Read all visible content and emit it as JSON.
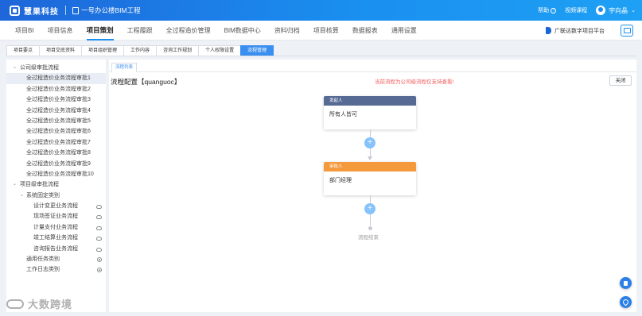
{
  "app": {
    "logo_text": "慧果科技",
    "project_name": "一号办公楼BIM工程"
  },
  "topbar": {
    "help_label": "帮助",
    "course_label": "视频课程",
    "user_name": "宇向晶"
  },
  "mainnav": {
    "items": [
      {
        "label": "项目BI"
      },
      {
        "label": "项目信息"
      },
      {
        "label": "项目策划"
      },
      {
        "label": "工程履跟"
      },
      {
        "label": "全过程造价管理"
      },
      {
        "label": "BIM数据中心"
      },
      {
        "label": "资料归档"
      },
      {
        "label": "项目核算"
      },
      {
        "label": "数据报表"
      },
      {
        "label": "通用设置"
      }
    ],
    "active_index": 2,
    "platform_label": "广联达数字项目平台"
  },
  "subtabs": [
    {
      "label": "项目要点"
    },
    {
      "label": "项目交底资料"
    },
    {
      "label": "项目组织管理"
    },
    {
      "label": "工作内容"
    },
    {
      "label": "咨询工作规划"
    },
    {
      "label": "个人权限设置"
    },
    {
      "label": "流程管理"
    }
  ],
  "sidebar": {
    "group1": "公司级审批流程",
    "company_flows": [
      "全过程造价业务流程审批1",
      "全过程造价业务流程审批2",
      "全过程造价业务流程审批3",
      "全过程造价业务流程审批4",
      "全过程造价业务流程审批5",
      "全过程造价业务流程审批6",
      "全过程造价业务流程审批7",
      "全过程造价业务流程审批8",
      "全过程造价业务流程审批9",
      "全过程造价业务流程审批10"
    ],
    "group2": "项目级审批流程",
    "subgroup": "系统固定类别",
    "system_flows": [
      "设计变更业务流程",
      "现场签证业务流程",
      "计量支付业务流程",
      "竣工结算业务流程",
      "咨询报告业务流程"
    ],
    "general_category": "通用任务类别",
    "worklog_category": "工作日志类别"
  },
  "content": {
    "tab_label": "流程列表",
    "title": "流程配置【quanguoc】",
    "notice": "当前流程为公司级流程仅支持查看!",
    "close_label": "关闭",
    "start_node": {
      "header": "发起人",
      "body": "所有人皆可"
    },
    "approve_node": {
      "header": "审批人",
      "body": "部门经理"
    },
    "end_label": "流程结束",
    "add_symbol": "+"
  },
  "watermark": "大数跨境",
  "colors": {
    "primary": "#1a8ff0",
    "start_header": "#576a94",
    "approve_header": "#f59a3c",
    "notice": "#f05a5a"
  }
}
